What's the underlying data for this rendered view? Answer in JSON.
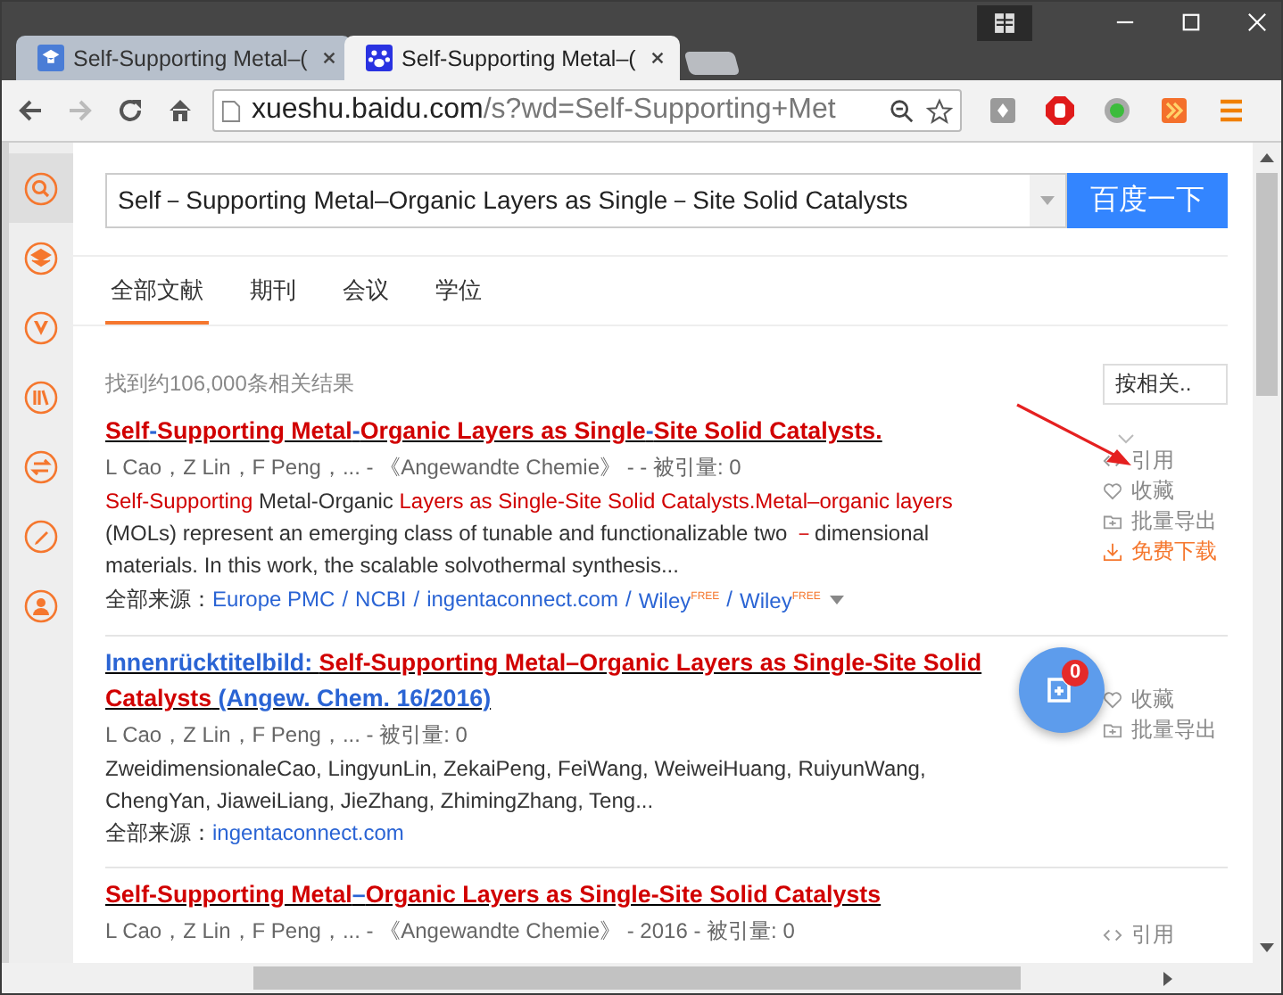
{
  "browser": {
    "tabs": [
      {
        "title": "Self-Supporting Metal–(",
        "selected": false,
        "kind": "scholar"
      },
      {
        "title": "Self-Supporting Metal–(",
        "selected": true,
        "kind": "paw"
      }
    ],
    "address": {
      "host": "xueshu.baidu.com",
      "path": "/s?wd=Self-Supporting+Met"
    }
  },
  "search": {
    "value": "Self－Supporting Metal–Organic Layers as Single－Site Solid Catalysts",
    "button": "百度一下"
  },
  "filter_tabs": [
    {
      "label": "全部文献",
      "selected": true
    },
    {
      "label": "期刊",
      "selected": false
    },
    {
      "label": "会议",
      "selected": false
    },
    {
      "label": "学位",
      "selected": false
    }
  ],
  "result_count": "找到约106,000条相关结果",
  "sort": {
    "label": "按相关.."
  },
  "sidebar": [
    {
      "kind": "search",
      "selected": true
    },
    {
      "kind": "layers",
      "selected": false
    },
    {
      "kind": "v",
      "selected": false
    },
    {
      "kind": "books",
      "selected": false
    },
    {
      "kind": "swap",
      "selected": false
    },
    {
      "kind": "pen",
      "selected": false
    },
    {
      "kind": "user",
      "selected": false
    }
  ],
  "results": [
    {
      "title": [
        {
          "text": "Self",
          "highlight": true
        },
        {
          "text": "-",
          "highlight": false
        },
        {
          "text": "Supporting Metal",
          "highlight": true
        },
        {
          "text": "-",
          "highlight": false
        },
        {
          "text": "Organic Layers as Single",
          "highlight": true
        },
        {
          "text": "-",
          "highlight": false
        },
        {
          "text": "Site Solid Catalysts.",
          "highlight": true
        }
      ],
      "meta": "L Cao，Z Lin，F Peng，... - 《Angewandte Chemie》 - - 被引量: 0",
      "abstract": [
        {
          "text": "Self-Supporting",
          "highlight": true
        },
        {
          "text": " Metal-Organic ",
          "highlight": false
        },
        {
          "text": "Layers as Single-Site Solid Catalysts.Metal–organic layers",
          "highlight": true
        },
        {
          "text": " (MOLs) represent an emerging class of tunable and functionalizable two ",
          "highlight": false
        },
        {
          "text": "－",
          "highlight": true
        },
        {
          "text": "dimensional materials. In this work, the scalable solvothermal synthesis...",
          "highlight": false
        }
      ],
      "sources_label": "全部来源：",
      "separator": "/",
      "sources": [
        "Europe PMC",
        "NCBI",
        "ingentaconnect.com",
        "Wiley$^{FREE}$",
        "Wiley$^{FREE}$"
      ],
      "sources_more": true,
      "actions": [
        {
          "kind": "cite",
          "label": "引用"
        },
        {
          "kind": "favorite",
          "label": "收藏"
        },
        {
          "kind": "export",
          "label": "批量导出"
        },
        {
          "kind": "download",
          "label": "免费下载"
        }
      ]
    },
    {
      "title": [
        {
          "text": "Innenrücktitelbild: ",
          "highlight": false
        },
        {
          "text": "Self-Supporting Metal–Organic Layers as Single-Site Solid Catalysts",
          "highlight": true
        },
        {
          "text": " (Angew. Chem. 16/2016)",
          "highlight": false
        }
      ],
      "meta": "L Cao，Z Lin，F Peng，... - 被引量: 0",
      "abstract": [
        {
          "text": "ZweidimensionaleCao, LingyunLin, ZekaiPeng, FeiWang, WeiweiHuang, RuiyunWang, ChengYan, JiaweiLiang, JieZhang, ZhimingZhang, Teng...",
          "highlight": false
        }
      ],
      "sources_label": "全部来源：",
      "sources": [
        "ingentaconnect.com"
      ],
      "sources_more": false,
      "actions": [
        {
          "kind": "favorite",
          "label": "收藏"
        },
        {
          "kind": "export",
          "label": "批量导出"
        }
      ]
    },
    {
      "title": [
        {
          "text": "Self-Supporting Metal",
          "highlight": true
        },
        {
          "text": "–",
          "highlight": false
        },
        {
          "text": "Organic Layers as Single-Site Solid Catalysts",
          "highlight": true
        }
      ],
      "meta": "L Cao，Z Lin，F Peng，... - 《Angewandte Chemie》 - 2016 - 被引量: 0",
      "actions": [
        {
          "kind": "cite",
          "label": "引用"
        }
      ]
    }
  ],
  "floating_button": {
    "badge": "0"
  }
}
